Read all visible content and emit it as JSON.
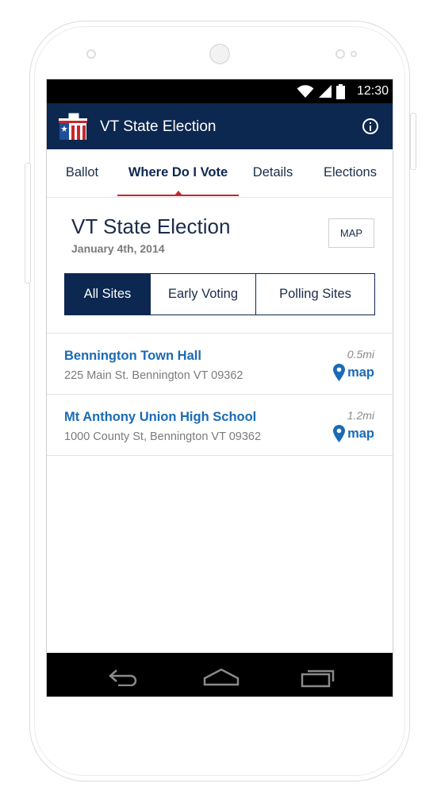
{
  "status_bar": {
    "time": "12:30"
  },
  "app_bar": {
    "title": "VT State Election"
  },
  "tabs": [
    {
      "label": "Ballot"
    },
    {
      "label": "Where Do I Vote"
    },
    {
      "label": "Details"
    },
    {
      "label": "Elections"
    }
  ],
  "election": {
    "title": "VT State Election",
    "date": "January 4th, 2014",
    "map_button": "MAP"
  },
  "filters": [
    {
      "label": "All Sites",
      "selected": true
    },
    {
      "label": "Early Voting",
      "selected": false
    },
    {
      "label": "Polling Sites",
      "selected": false
    }
  ],
  "sites": [
    {
      "name": "Bennington Town Hall",
      "address": "225 Main St. Bennington VT 09362",
      "distance": "0.5mi",
      "map_label": "map"
    },
    {
      "name": "Mt Anthony Union High School",
      "address": "1000 County St, Bennington VT 09362",
      "distance": "1.2mi",
      "map_label": "map"
    }
  ],
  "colors": {
    "primary": "#0c2750",
    "accent": "#c8262c",
    "link": "#1a6bb5"
  },
  "icons": [
    "wifi-icon",
    "signal-icon",
    "battery-icon",
    "ballot-box-icon",
    "info-icon",
    "map-pin-icon",
    "back-icon",
    "home-icon",
    "recent-apps-icon"
  ]
}
